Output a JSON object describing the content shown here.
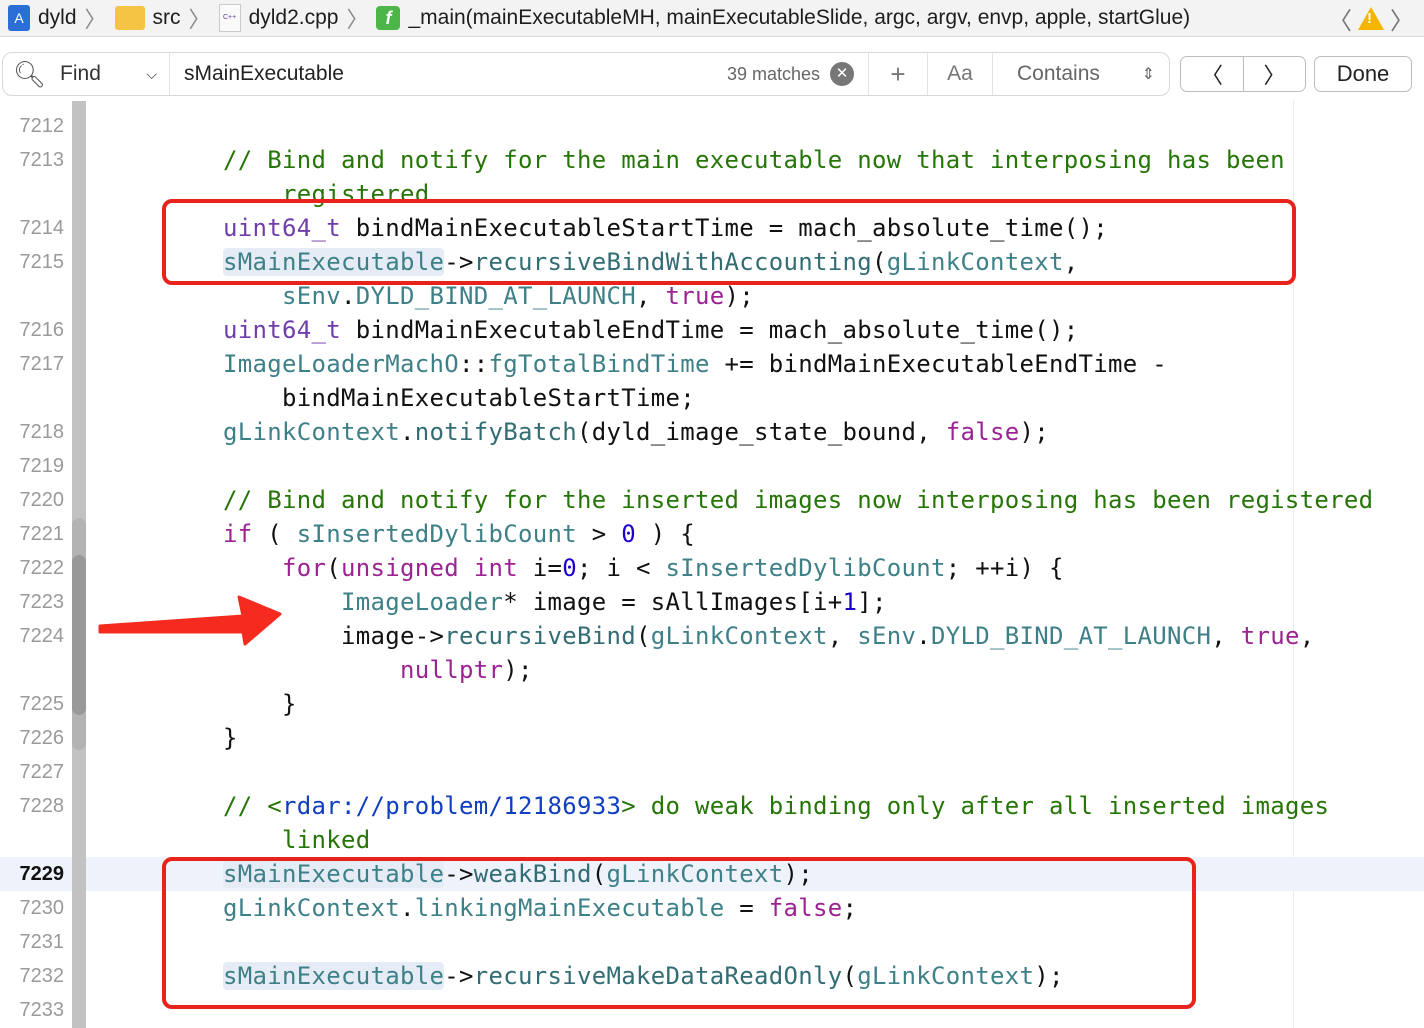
{
  "breadcrumb": [
    {
      "label": "dyld",
      "icon": "project-icon"
    },
    {
      "label": "src",
      "icon": "folder-icon"
    },
    {
      "label": "dyld2.cpp",
      "icon": "cpp-file-icon",
      "icon_text": "C++"
    },
    {
      "label": "_main(mainExecutableMH, mainExecutableSlide, argc, argv, envp, apple, startGlue)",
      "icon": "function-icon",
      "icon_text": "f"
    }
  ],
  "find": {
    "mode": "Find",
    "query": "sMainExecutable",
    "matches": "39 matches",
    "case_label": "Aa",
    "match_type": "Contains",
    "done": "Done"
  },
  "colors": {
    "comment": "#267507",
    "keyword": "#9b2393",
    "type": "#703daa",
    "identifier": "#3e8087",
    "number": "#1c00cf",
    "annotation": "#e8231c"
  },
  "current_line": "7229",
  "lines": [
    {
      "n": "7212",
      "t": []
    },
    {
      "n": "7213",
      "t": [
        [
          "        // Bind and notify for the main executable now that interposing has been",
          "cm"
        ]
      ]
    },
    {
      "n": "",
      "t": [
        [
          "            registered",
          "cm"
        ]
      ]
    },
    {
      "n": "7214",
      "t": [
        [
          "        ",
          "pl"
        ],
        [
          "uint64_t",
          "ty"
        ],
        [
          " bindMainExecutableStartTime = mach_absolute_time();",
          "pl"
        ]
      ]
    },
    {
      "n": "7215",
      "t": [
        [
          "        ",
          "pl"
        ],
        [
          "sMainExecutable",
          "id hl"
        ],
        [
          "->",
          "pl"
        ],
        [
          "recursiveBindWithAccounting",
          "fn"
        ],
        [
          "(",
          "pl"
        ],
        [
          "gLinkContext",
          "id"
        ],
        [
          ",",
          "pl"
        ]
      ]
    },
    {
      "n": "",
      "t": [
        [
          "            ",
          "pl"
        ],
        [
          "sEnv",
          "id"
        ],
        [
          ".",
          "pl"
        ],
        [
          "DYLD_BIND_AT_LAUNCH",
          "id"
        ],
        [
          ", ",
          "pl"
        ],
        [
          "true",
          "kw"
        ],
        [
          ");",
          "pl"
        ]
      ]
    },
    {
      "n": "7216",
      "t": [
        [
          "        ",
          "pl"
        ],
        [
          "uint64_t",
          "ty"
        ],
        [
          " bindMainExecutableEndTime = mach_absolute_time();",
          "pl"
        ]
      ]
    },
    {
      "n": "7217",
      "t": [
        [
          "        ",
          "pl"
        ],
        [
          "ImageLoaderMachO",
          "id"
        ],
        [
          "::",
          "pl"
        ],
        [
          "fgTotalBindTime",
          "id"
        ],
        [
          " += bindMainExecutableEndTime -",
          "pl"
        ]
      ]
    },
    {
      "n": "",
      "t": [
        [
          "            bindMainExecutableStartTime;",
          "pl"
        ]
      ]
    },
    {
      "n": "7218",
      "t": [
        [
          "        ",
          "pl"
        ],
        [
          "gLinkContext",
          "id"
        ],
        [
          ".",
          "pl"
        ],
        [
          "notifyBatch",
          "fn"
        ],
        [
          "(dyld_image_state_bound, ",
          "pl"
        ],
        [
          "false",
          "kw"
        ],
        [
          ");",
          "pl"
        ]
      ]
    },
    {
      "n": "7219",
      "t": []
    },
    {
      "n": "7220",
      "t": [
        [
          "        // Bind and notify for the inserted images now interposing has been registered",
          "cm"
        ]
      ]
    },
    {
      "n": "7221",
      "t": [
        [
          "        ",
          "pl"
        ],
        [
          "if",
          "kw"
        ],
        [
          " ( ",
          "pl"
        ],
        [
          "sInsertedDylibCount",
          "id"
        ],
        [
          " > ",
          "pl"
        ],
        [
          "0",
          "num"
        ],
        [
          " ) {",
          "pl"
        ]
      ]
    },
    {
      "n": "7222",
      "t": [
        [
          "            ",
          "pl"
        ],
        [
          "for",
          "kw"
        ],
        [
          "(",
          "pl"
        ],
        [
          "unsigned",
          "kw"
        ],
        [
          " ",
          "pl"
        ],
        [
          "int",
          "kw"
        ],
        [
          " i=",
          "pl"
        ],
        [
          "0",
          "num"
        ],
        [
          "; i < ",
          "pl"
        ],
        [
          "sInsertedDylibCount",
          "id"
        ],
        [
          "; ++i) {",
          "pl"
        ]
      ]
    },
    {
      "n": "7223",
      "t": [
        [
          "                ",
          "pl"
        ],
        [
          "ImageLoader",
          "id"
        ],
        [
          "* image = sAllImages[i+",
          "pl"
        ],
        [
          "1",
          "num"
        ],
        [
          "];",
          "pl"
        ]
      ]
    },
    {
      "n": "7224",
      "t": [
        [
          "                image->",
          "pl"
        ],
        [
          "recursiveBind",
          "fn"
        ],
        [
          "(",
          "pl"
        ],
        [
          "gLinkContext",
          "id"
        ],
        [
          ", ",
          "pl"
        ],
        [
          "sEnv",
          "id"
        ],
        [
          ".",
          "pl"
        ],
        [
          "DYLD_BIND_AT_LAUNCH",
          "id"
        ],
        [
          ", ",
          "pl"
        ],
        [
          "true",
          "kw"
        ],
        [
          ",",
          "pl"
        ]
      ]
    },
    {
      "n": "",
      "t": [
        [
          "                    ",
          "pl"
        ],
        [
          "nullptr",
          "kw"
        ],
        [
          ");",
          "pl"
        ]
      ]
    },
    {
      "n": "7225",
      "t": [
        [
          "            }",
          "pl"
        ]
      ]
    },
    {
      "n": "7226",
      "t": [
        [
          "        }",
          "pl"
        ]
      ]
    },
    {
      "n": "7227",
      "t": []
    },
    {
      "n": "7228",
      "t": [
        [
          "        // <",
          "cm"
        ],
        [
          "rdar://problem/12186933",
          "url"
        ],
        [
          "> do weak binding only after all inserted images",
          "cm"
        ]
      ]
    },
    {
      "n": "",
      "t": [
        [
          "            linked",
          "cm"
        ]
      ]
    },
    {
      "n": "7229",
      "t": [
        [
          "        ",
          "pl"
        ],
        [
          "sMainExecutable",
          "id hl"
        ],
        [
          "->",
          "pl"
        ],
        [
          "weakBind",
          "fn"
        ],
        [
          "(",
          "pl"
        ],
        [
          "gLinkContext",
          "id"
        ],
        [
          ");",
          "pl"
        ]
      ]
    },
    {
      "n": "7230",
      "t": [
        [
          "        ",
          "pl"
        ],
        [
          "gLinkContext",
          "id"
        ],
        [
          ".",
          "pl"
        ],
        [
          "linkingMainExecutable",
          "id"
        ],
        [
          " = ",
          "pl"
        ],
        [
          "false",
          "kw"
        ],
        [
          ";",
          "pl"
        ]
      ]
    },
    {
      "n": "7231",
      "t": []
    },
    {
      "n": "7232",
      "t": [
        [
          "        ",
          "pl"
        ],
        [
          "sMainExecutable",
          "id hl"
        ],
        [
          "->",
          "pl"
        ],
        [
          "recursiveMakeDataReadOnly",
          "fn"
        ],
        [
          "(",
          "pl"
        ],
        [
          "gLinkContext",
          "id"
        ],
        [
          ");",
          "pl"
        ]
      ]
    },
    {
      "n": "7233",
      "t": []
    }
  ]
}
